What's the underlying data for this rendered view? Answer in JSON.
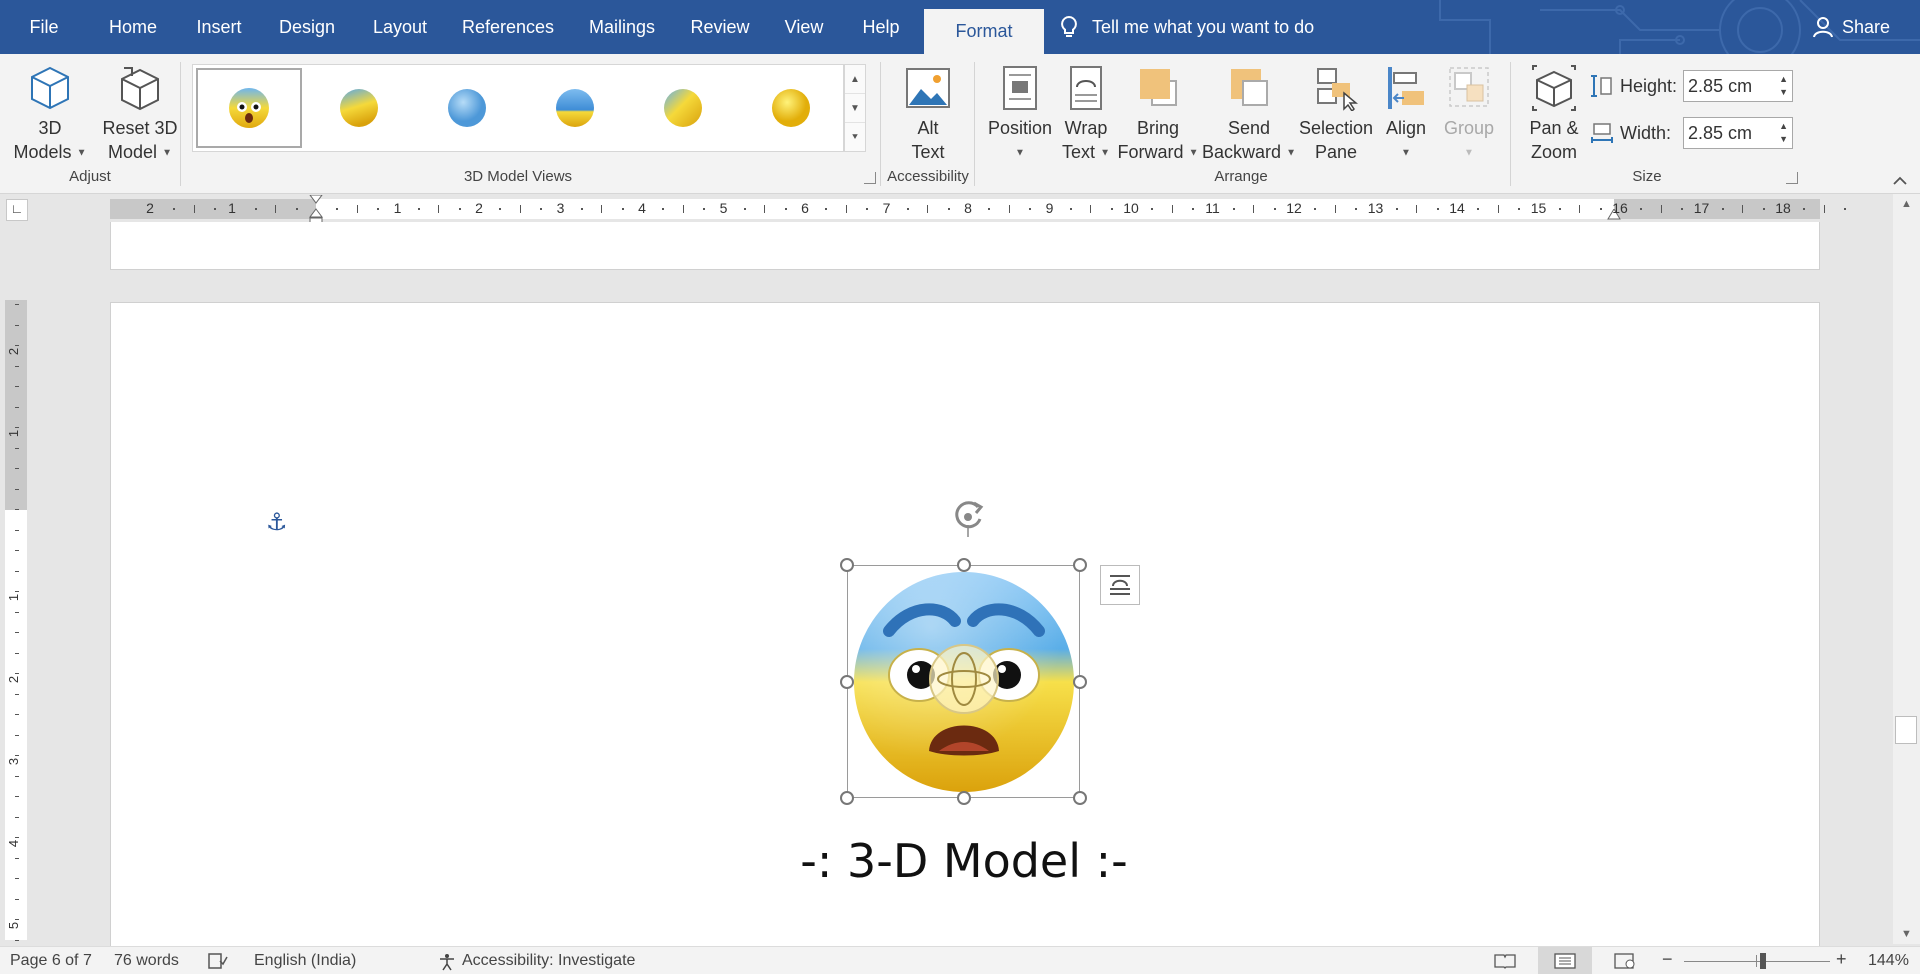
{
  "tabs": [
    {
      "label": "File"
    },
    {
      "label": "Home"
    },
    {
      "label": "Insert"
    },
    {
      "label": "Design"
    },
    {
      "label": "Layout"
    },
    {
      "label": "References"
    },
    {
      "label": "Mailings"
    },
    {
      "label": "Review"
    },
    {
      "label": "View"
    },
    {
      "label": "Help"
    },
    {
      "label": "Format"
    }
  ],
  "active_tab": "Format",
  "tell_me": "Tell me what you want to do",
  "share_label": "Share",
  "ribbon": {
    "adjust": {
      "models_line1": "3D",
      "models_line2": "Models",
      "reset_line1": "Reset 3D",
      "reset_line2": "Model",
      "group_label": "Adjust"
    },
    "views": {
      "group_label": "3D Model Views",
      "items": [
        "view-1",
        "view-2",
        "view-3",
        "view-4",
        "view-5",
        "view-6"
      ]
    },
    "accessibility": {
      "alt_line1": "Alt",
      "alt_line2": "Text",
      "group_label": "Accessibility"
    },
    "arrange": {
      "position_label": "Position",
      "wrap_line1": "Wrap",
      "wrap_line2": "Text",
      "bring_line1": "Bring",
      "bring_line2": "Forward",
      "send_line1": "Send",
      "send_line2": "Backward",
      "selection_line1": "Selection",
      "selection_line2": "Pane",
      "align_label": "Align",
      "group_btn_label": "Group",
      "group_label": "Arrange"
    },
    "size": {
      "pan_line1": "Pan &",
      "pan_line2": "Zoom",
      "height_label": "Height:",
      "height_value": "2.85 cm",
      "width_label": "Width:",
      "width_value": "2.85 cm",
      "group_label": "Size"
    }
  },
  "ruler": {
    "left_numbers": [
      "2",
      "1"
    ],
    "numbers": [
      "1",
      "2",
      "3",
      "4",
      "5",
      "6",
      "7",
      "8",
      "9",
      "10",
      "11",
      "12",
      "13",
      "14",
      "15",
      "16",
      "17",
      "18"
    ],
    "vertical_numbers": [
      "2",
      "1",
      "1",
      "2",
      "3",
      "4",
      "5"
    ]
  },
  "document": {
    "heading": "-: 3-D Model :-"
  },
  "status": {
    "page": "Page 6 of 7",
    "words": "76 words",
    "language": "English (India)",
    "accessibility": "Accessibility: Investigate",
    "zoom_level": "144%"
  },
  "colors": {
    "title_bar": "#2b579a",
    "ribbon": "#f3f3f3",
    "accent": "#2b579a"
  }
}
